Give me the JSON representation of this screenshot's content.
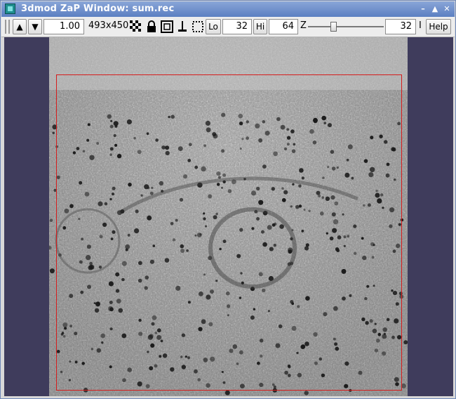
{
  "window": {
    "title": "3dmod ZaP Window: sum.rec"
  },
  "toolbar": {
    "zoom_value": "1.00",
    "image_size": "493x450",
    "lo_label": "Lo",
    "lo_value": "32",
    "hi_label": "Hi",
    "hi_value": "64",
    "z_label": "Z",
    "z_value": "32",
    "i_label": "I",
    "help_label": "Help",
    "z_slider_fraction": 0.33
  },
  "colors": {
    "background": "#3f3c5c",
    "selection_box": "#d61c1c"
  },
  "icons": [
    "app-icon",
    "up-arrow-icon",
    "down-arrow-icon",
    "checker-icon",
    "lock-icon",
    "square-icon",
    "pin-icon",
    "dotted-square-icon"
  ]
}
